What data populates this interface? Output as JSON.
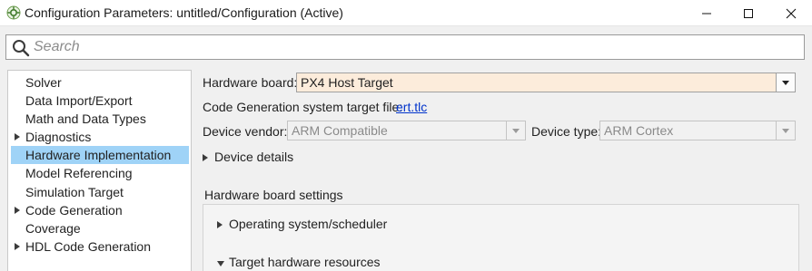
{
  "window": {
    "title": "Configuration Parameters: untitled/Configuration (Active)",
    "controls": {
      "minimize": "minimize",
      "maximize": "maximize",
      "close": "close"
    }
  },
  "search": {
    "placeholder": "Search",
    "value": ""
  },
  "sidebar": {
    "items": [
      {
        "label": "Solver",
        "expandable": false,
        "selected": false
      },
      {
        "label": "Data Import/Export",
        "expandable": false,
        "selected": false
      },
      {
        "label": "Math and Data Types",
        "expandable": false,
        "selected": false
      },
      {
        "label": "Diagnostics",
        "expandable": true,
        "selected": false
      },
      {
        "label": "Hardware Implementation",
        "expandable": false,
        "selected": true
      },
      {
        "label": "Model Referencing",
        "expandable": false,
        "selected": false
      },
      {
        "label": "Simulation Target",
        "expandable": false,
        "selected": false
      },
      {
        "label": "Code Generation",
        "expandable": true,
        "selected": false
      },
      {
        "label": "Coverage",
        "expandable": false,
        "selected": false
      },
      {
        "label": "HDL Code Generation",
        "expandable": true,
        "selected": false
      }
    ]
  },
  "main": {
    "hardware_board": {
      "label": "Hardware board:",
      "value": "PX4 Host Target"
    },
    "target_file": {
      "label": "Code Generation system target file:",
      "link": "ert.tlc"
    },
    "device_vendor": {
      "label": "Device vendor:",
      "value": "ARM Compatible"
    },
    "device_type": {
      "label": "Device type:",
      "value": "ARM Cortex"
    },
    "device_details": {
      "label": "Device details"
    },
    "board_settings": {
      "heading": "Hardware board settings",
      "sections": [
        {
          "label": "Operating system/scheduler",
          "expanded": false
        },
        {
          "label": "Target hardware resources",
          "expanded": true
        }
      ]
    }
  },
  "colors": {
    "selection": "#9fd3f7",
    "board_dropdown_bg": "#fcecdb",
    "link": "#0033cc",
    "disabled_text": "#8a8a8a"
  },
  "icons": {
    "app": "matlab-config-icon",
    "search": "search-icon",
    "expand": "triangle-right-icon",
    "collapse": "triangle-down-icon",
    "dropdown": "chevron-down-icon"
  }
}
